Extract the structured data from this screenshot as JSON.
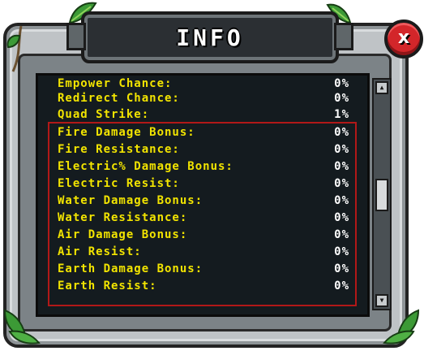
{
  "window": {
    "title": "INFO",
    "close_label": "x"
  },
  "stats": [
    {
      "label": "Empower Chance:",
      "value": "0%"
    },
    {
      "label": "Redirect Chance:",
      "value": "0%"
    },
    {
      "label": "Quad Strike:",
      "value": "1%"
    },
    {
      "label": "Fire Damage Bonus:",
      "value": "0%"
    },
    {
      "label": "Fire Resistance:",
      "value": "0%"
    },
    {
      "label": "Electric% Damage Bonus:",
      "value": "0%"
    },
    {
      "label": "Electric Resist:",
      "value": "0%"
    },
    {
      "label": "Water Damage Bonus:",
      "value": "0%"
    },
    {
      "label": "Water Resistance:",
      "value": "0%"
    },
    {
      "label": "Air Damage Bonus:",
      "value": "0%"
    },
    {
      "label": "Air Resist:",
      "value": "0%"
    },
    {
      "label": "Earth Damage Bonus:",
      "value": "0%"
    },
    {
      "label": "Earth Resist:",
      "value": "0%"
    }
  ],
  "colors": {
    "label": "#f2e400",
    "value": "#ffffff",
    "highlight": "#b21818",
    "close": "#d3262a"
  },
  "icons": [
    "close-icon",
    "leaf-decoration-icon",
    "scroll-up-icon",
    "scroll-down-icon"
  ]
}
